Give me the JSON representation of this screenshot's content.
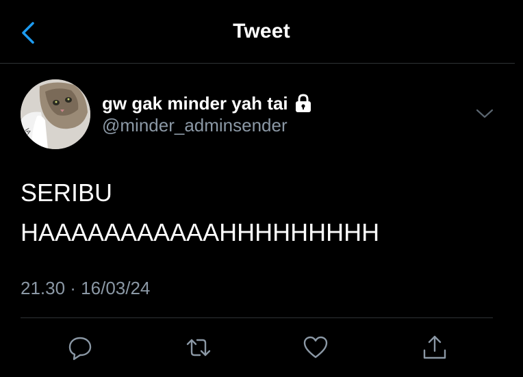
{
  "header": {
    "title": "Tweet",
    "back_icon": "chevron-left-icon",
    "accent_color": "#1d9bf0"
  },
  "tweet": {
    "author": {
      "display_name": "gw gak minder yah tai",
      "handle": "@minder_adminsender",
      "protected": true,
      "lock_icon": "lock-icon",
      "avatar": "cat-photo-avatar"
    },
    "menu_icon": "chevron-down-icon",
    "text_lines": [
      "SERIBU",
      "HAAAAAAAAAAAHHHHHHHHH"
    ],
    "timestamp": "21.30 · 16/03/24"
  },
  "actions": [
    {
      "name": "reply",
      "icon": "reply-bubble-icon"
    },
    {
      "name": "retweet",
      "icon": "retweet-icon"
    },
    {
      "name": "like",
      "icon": "heart-icon"
    },
    {
      "name": "share",
      "icon": "share-icon"
    }
  ],
  "colors": {
    "background": "#000000",
    "text": "#ffffff",
    "secondary_text": "#8b98a5",
    "divider": "#2f3336"
  }
}
